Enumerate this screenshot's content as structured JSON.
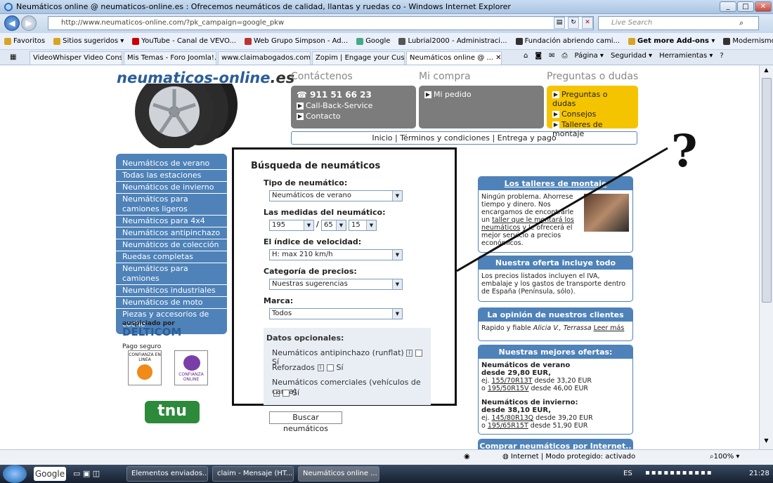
{
  "window": {
    "title": "Neumáticos online @ neumaticos-online.es : Ofrecemos neumáticos de calidad, llantas y ruedas co - Windows Internet Explorer"
  },
  "address": {
    "url": "http://www.neumaticos-online.com/?pk_campaign=google_pkw",
    "search_placeholder": "Live Search"
  },
  "favorites": [
    "Favoritos",
    "Sitios sugeridos ▾",
    "YouTube - Canal de VEVO...",
    "Web Grupo Simpson - Ad...",
    "Google",
    "Lubrial2000 - Administraci...",
    "Fundación abriendo cami...",
    "Get more Add-ons ▾",
    "Modernismo 98 y 14 - Ad..."
  ],
  "tabs": [
    "VideoWhisper Video Cons...",
    "Mis Temas - Foro Joomla!...",
    "www.claimabogados.com...",
    "Zopim | Engage your Cust...",
    "Neumáticos online @ ..."
  ],
  "commandbar": {
    "page": "Página ▾",
    "security": "Seguridad ▾",
    "tools": "Herramientas ▾"
  },
  "site": {
    "logo": "neumaticos-online",
    "logo_tld": ".es",
    "header": {
      "contact_title": "Contáctenos",
      "purchase_title": "Mi compra",
      "faq_title": "Preguntas o dudas",
      "phone": "911 51 66 23",
      "contact_items": [
        "Call-Back-Service",
        "Contacto"
      ],
      "purchase_items": [
        "Mi pedido"
      ],
      "faq_items": [
        "Preguntas o dudas",
        "Consejos",
        "Talleres de montaje"
      ]
    },
    "navlinks": "Inicio | Términos y condiciones | Entrega y pago",
    "sidebar": [
      "Neumáticos de verano",
      "Todas las estaciones",
      "Neumáticos de invierno",
      "Neumáticos para camiones ligeros",
      "Neumáticos para 4x4",
      "Neumáticos antipinchazo",
      "Neumáticos de colección",
      "Ruedas completas",
      "Neumáticos para camiones",
      "Neumáticos industriales",
      "Neumáticos de moto",
      "Piezas y accesorios de coche"
    ],
    "sponsor": {
      "label": "auspiciado por",
      "name": "DELTICOM"
    },
    "payment": {
      "label": "Pago seguro",
      "badge1": "CONFIANZA EN LINEA",
      "badge2": "CONFIANZA ONLINE"
    },
    "tnu": "tnu",
    "form": {
      "title": "Búsqueda de neumáticos",
      "type_label": "Tipo de neumático:",
      "type_value": "Neumáticos de verano",
      "size_label": "Las medidas del neumático:",
      "width": "195",
      "sep": "/",
      "ratio": "65",
      "rim": "15",
      "speed_label": "El índice de velocidad:",
      "speed_value": "H: max 210 km/h",
      "price_label": "Categoría de precios:",
      "price_value": "Nuestras sugerencias",
      "brand_label": "Marca:",
      "brand_value": "Todos",
      "optional_label": "Datos opcionales:",
      "runflat": "Neumáticos antipinchazo (runflat)",
      "reinforced": "Reforzados",
      "commercial": "Neumáticos comerciales (vehículos de carga)",
      "yes": "Sí",
      "submit": "Buscar neumáticos"
    },
    "right": {
      "workshops_title": "Los talleres de montaje",
      "workshops_text_1": "Ningún problema. Ahorrese tiempo y dinero. Nos encargamos de encontrarle un",
      "workshops_link": "taller que le montará los neumáticos",
      "workshops_text_2": "y le ofrecerá el mejor servicio a precios económicos.",
      "offer_title": "Nuestra oferta incluye todo",
      "offer_text": "Los precios listados incluyen el IVA, embalaje y los gastos de transporte dentro de España (Península, sólo).",
      "opinion_title": "La opinión de nuestros clientes",
      "opinion_text": "Rapido y fiable",
      "opinion_author": "Alicia V., Terrassa",
      "opinion_more": "Leer más",
      "best_title": "Nuestras mejores ofertas:",
      "summer_head": "Neumáticos de verano",
      "summer_from": "desde 29,80 EUR,",
      "summer_ex": "ej.",
      "summer_link1": "155/70R13T",
      "summer_p1": "desde 33,20 EUR",
      "summer_o": "o",
      "summer_link2": "195/50R15V",
      "summer_p2": "desde 46,00 EUR",
      "winter_head": "Neumáticos de invierno:",
      "winter_from": "desde 38,10 EUR,",
      "winter_link1": "145/80R13Q",
      "winter_p1": "desde 39,20 EUR",
      "winter_link2": "195/65R15T",
      "winter_p2": "desde 51,90 EUR",
      "buy_title": "Comprar neumáticos por Internet.. :"
    },
    "annotation": "?"
  },
  "status": {
    "zone": "Internet | Modo protegido: activado",
    "zoom": "100%"
  },
  "taskbar": {
    "google": "Google",
    "tasks": [
      "Elementos enviados...",
      "claim - Mensaje (HT...",
      "Neumáticos online ..."
    ],
    "lang": "ES",
    "time": "21:28"
  }
}
